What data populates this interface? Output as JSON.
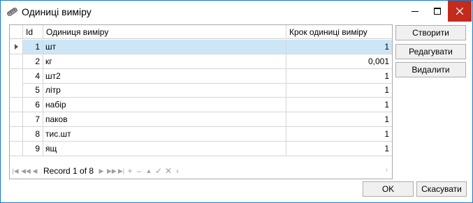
{
  "window": {
    "title": "Одиниці виміру",
    "title_icon": "ruler-icon",
    "controls": [
      "minimize-icon",
      "maximize-icon",
      "close-icon"
    ],
    "close_color": "#c42b1c"
  },
  "grid": {
    "columns": {
      "id": "Id",
      "name": "Одиниця виміру",
      "step": "Крок одиниці виміру"
    },
    "selected_row": 0,
    "selected_color": "#cde6f7",
    "rows": [
      {
        "id": "1",
        "name": "шт",
        "step": "1"
      },
      {
        "id": "2",
        "name": "кг",
        "step": "0,001"
      },
      {
        "id": "4",
        "name": "шт2",
        "step": "1"
      },
      {
        "id": "5",
        "name": "літр",
        "step": "1"
      },
      {
        "id": "6",
        "name": "набір",
        "step": "1"
      },
      {
        "id": "7",
        "name": "паков",
        "step": "1"
      },
      {
        "id": "8",
        "name": "тис.шт",
        "step": "1"
      },
      {
        "id": "9",
        "name": "ящ",
        "step": "1"
      }
    ],
    "navigator": {
      "record_text": "Record 1 of 8",
      "buttons": [
        "first-icon",
        "prev-page-icon",
        "prev-icon",
        "next-icon",
        "next-page-icon",
        "last-icon",
        "add-icon",
        "remove-icon",
        "up-icon",
        "apply-icon",
        "cancel-edit-icon",
        "filter-icon"
      ]
    }
  },
  "actions": {
    "create": "Створити",
    "edit": "Редагувати",
    "delete": "Видалити"
  },
  "footer": {
    "ok": "OK",
    "cancel": "Скасувати"
  }
}
